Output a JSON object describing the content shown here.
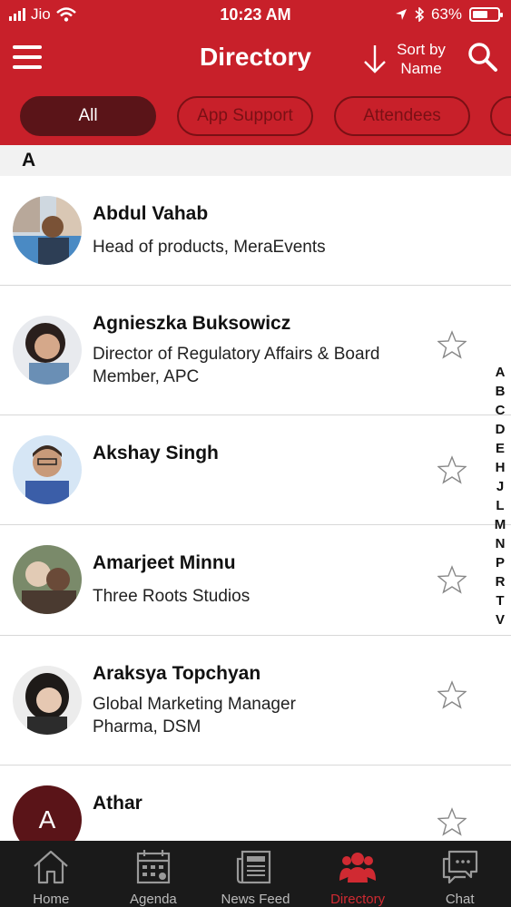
{
  "status_bar": {
    "carrier": "Jio",
    "time": "10:23 AM",
    "battery": "63%",
    "battery_level": 0.63
  },
  "header": {
    "title": "Directory",
    "sort_label_line1": "Sort by",
    "sort_label_line2": "Name"
  },
  "filters": [
    {
      "label": "All",
      "active": true
    },
    {
      "label": "App Support",
      "active": false
    },
    {
      "label": "Attendees",
      "active": false
    }
  ],
  "section_letter": "A",
  "contacts": [
    {
      "name": "Abdul Vahab",
      "subtitle_line1": "Head of products, MeraEvents",
      "subtitle_line2": "",
      "favorite_icon": false
    },
    {
      "name": "Agnieszka Buksowicz",
      "subtitle_line1": "Director of Regulatory Affairs & Board",
      "subtitle_line2": "Member, APC",
      "favorite_icon": true
    },
    {
      "name": "Akshay Singh",
      "subtitle_line1": "",
      "subtitle_line2": "",
      "favorite_icon": true
    },
    {
      "name": "Amarjeet Minnu",
      "subtitle_line1": "Three Roots Studios",
      "subtitle_line2": "",
      "favorite_icon": true
    },
    {
      "name": "Araksya Topchyan",
      "subtitle_line1": "Global Marketing Manager",
      "subtitle_line2": "Pharma, DSM",
      "favorite_icon": true
    },
    {
      "name": "Athar",
      "subtitle_line1": "",
      "subtitle_line2": "",
      "favorite_icon": true,
      "initial": "A"
    }
  ],
  "alpha_index": [
    "A",
    "B",
    "C",
    "D",
    "E",
    "H",
    "J",
    "L",
    "M",
    "N",
    "P",
    "R",
    "T",
    "V"
  ],
  "tabs": [
    {
      "label": "Home",
      "icon": "home-icon",
      "active": false
    },
    {
      "label": "Agenda",
      "icon": "calendar-icon",
      "active": false
    },
    {
      "label": "News Feed",
      "icon": "newspaper-icon",
      "active": false
    },
    {
      "label": "Directory",
      "icon": "people-icon",
      "active": true
    },
    {
      "label": "Chat",
      "icon": "chat-icon",
      "active": false
    }
  ],
  "colors": {
    "brand_red": "#c8202a",
    "chip_active": "#5a1418",
    "tab_active": "#d02a32",
    "tabbar_bg": "#1a1a1a"
  }
}
